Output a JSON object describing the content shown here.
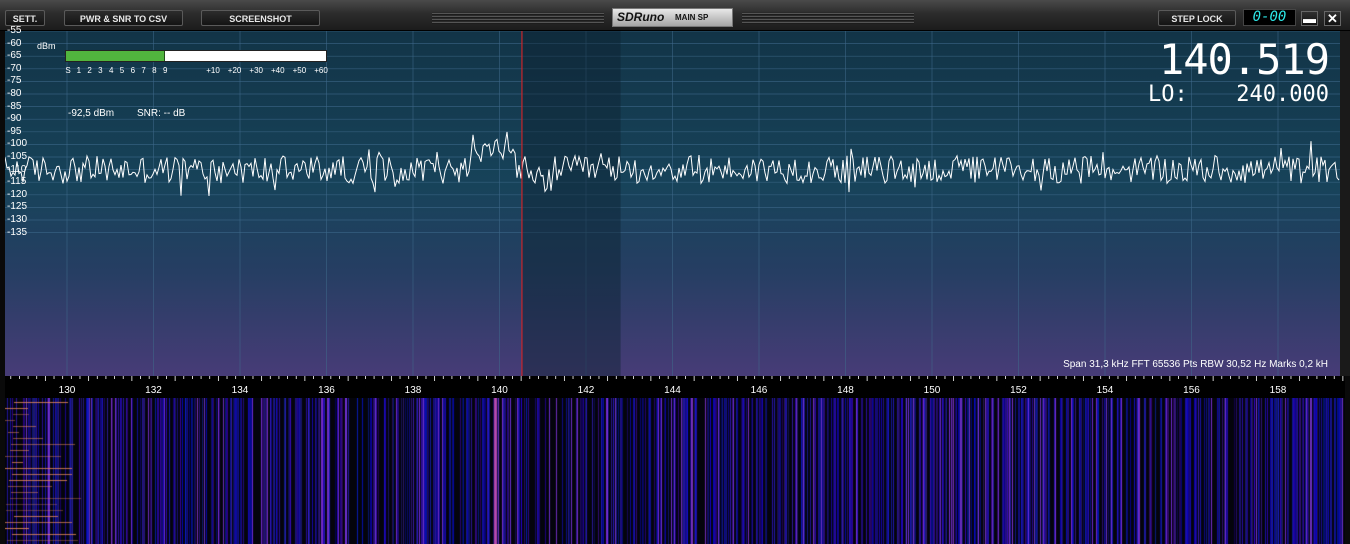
{
  "toolbar": {
    "sett_label": "SETT.",
    "pwr_snr_label": "PWR & SNR TO CSV",
    "screenshot_label": "SCREENSHOT",
    "step_lock_label": "STEP LOCK",
    "counter": "0-00",
    "minimize_symbol": "▬",
    "close_symbol": "✕"
  },
  "brand": {
    "logo": "SDRuno",
    "window_name": "MAIN SP"
  },
  "smeter": {
    "unit": "dBm",
    "scale": [
      "S",
      "1",
      "2",
      "3",
      "4",
      "5",
      "6",
      "7",
      "8",
      "9",
      "+10",
      "+20",
      "+30",
      "+40",
      "+50",
      "+60"
    ],
    "level_fraction": 0.375,
    "power": "-92,5 dBm",
    "snr": "SNR: -- dB"
  },
  "frequency": {
    "main": "140.519",
    "lo_label": "LO:",
    "lo_value": "240.000"
  },
  "status_line": "Span 31,3 kHz   FFT 65536 Pts   RBW 30,52 Hz   Marks 0,2 kH",
  "y_axis_labels": [
    "-55",
    "-60",
    "-65",
    "-70",
    "-75",
    "-80",
    "-85",
    "-90",
    "-95",
    "-100",
    "-105",
    "-110",
    "-115",
    "-120",
    "-125",
    "-130",
    "-135"
  ],
  "x_axis_labels": [
    "130",
    "132",
    "134",
    "136",
    "138",
    "140",
    "142",
    "144",
    "146",
    "148",
    "150",
    "152",
    "154",
    "156",
    "158"
  ],
  "colors": {
    "trace": "#ffffff",
    "marker_line": "#c8252a",
    "filter_band": "#0d2230",
    "smeter_fill": "#51b53e",
    "display_cyan": "#2de7e7"
  },
  "icons": {
    "minimize": "minimize-icon",
    "close": "close-icon"
  }
}
